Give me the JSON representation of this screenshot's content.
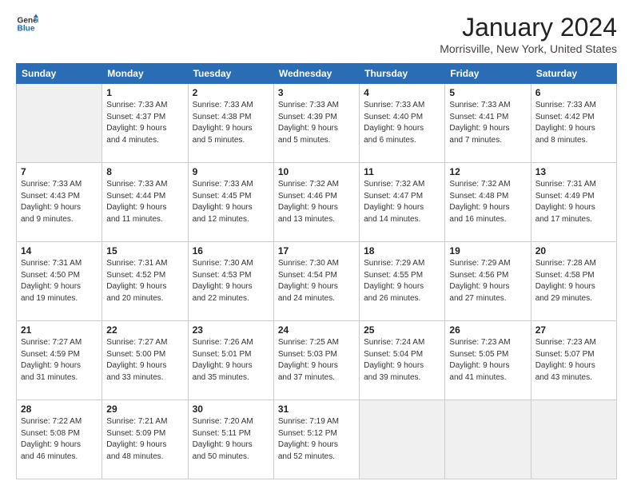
{
  "logo": {
    "line1": "General",
    "line2": "Blue"
  },
  "title": "January 2024",
  "location": "Morrisville, New York, United States",
  "days_header": [
    "Sunday",
    "Monday",
    "Tuesday",
    "Wednesday",
    "Thursday",
    "Friday",
    "Saturday"
  ],
  "weeks": [
    [
      {
        "day": "",
        "info": ""
      },
      {
        "day": "1",
        "info": "Sunrise: 7:33 AM\nSunset: 4:37 PM\nDaylight: 9 hours\nand 4 minutes."
      },
      {
        "day": "2",
        "info": "Sunrise: 7:33 AM\nSunset: 4:38 PM\nDaylight: 9 hours\nand 5 minutes."
      },
      {
        "day": "3",
        "info": "Sunrise: 7:33 AM\nSunset: 4:39 PM\nDaylight: 9 hours\nand 5 minutes."
      },
      {
        "day": "4",
        "info": "Sunrise: 7:33 AM\nSunset: 4:40 PM\nDaylight: 9 hours\nand 6 minutes."
      },
      {
        "day": "5",
        "info": "Sunrise: 7:33 AM\nSunset: 4:41 PM\nDaylight: 9 hours\nand 7 minutes."
      },
      {
        "day": "6",
        "info": "Sunrise: 7:33 AM\nSunset: 4:42 PM\nDaylight: 9 hours\nand 8 minutes."
      }
    ],
    [
      {
        "day": "7",
        "info": "Sunrise: 7:33 AM\nSunset: 4:43 PM\nDaylight: 9 hours\nand 9 minutes."
      },
      {
        "day": "8",
        "info": "Sunrise: 7:33 AM\nSunset: 4:44 PM\nDaylight: 9 hours\nand 11 minutes."
      },
      {
        "day": "9",
        "info": "Sunrise: 7:33 AM\nSunset: 4:45 PM\nDaylight: 9 hours\nand 12 minutes."
      },
      {
        "day": "10",
        "info": "Sunrise: 7:32 AM\nSunset: 4:46 PM\nDaylight: 9 hours\nand 13 minutes."
      },
      {
        "day": "11",
        "info": "Sunrise: 7:32 AM\nSunset: 4:47 PM\nDaylight: 9 hours\nand 14 minutes."
      },
      {
        "day": "12",
        "info": "Sunrise: 7:32 AM\nSunset: 4:48 PM\nDaylight: 9 hours\nand 16 minutes."
      },
      {
        "day": "13",
        "info": "Sunrise: 7:31 AM\nSunset: 4:49 PM\nDaylight: 9 hours\nand 17 minutes."
      }
    ],
    [
      {
        "day": "14",
        "info": "Sunrise: 7:31 AM\nSunset: 4:50 PM\nDaylight: 9 hours\nand 19 minutes."
      },
      {
        "day": "15",
        "info": "Sunrise: 7:31 AM\nSunset: 4:52 PM\nDaylight: 9 hours\nand 20 minutes."
      },
      {
        "day": "16",
        "info": "Sunrise: 7:30 AM\nSunset: 4:53 PM\nDaylight: 9 hours\nand 22 minutes."
      },
      {
        "day": "17",
        "info": "Sunrise: 7:30 AM\nSunset: 4:54 PM\nDaylight: 9 hours\nand 24 minutes."
      },
      {
        "day": "18",
        "info": "Sunrise: 7:29 AM\nSunset: 4:55 PM\nDaylight: 9 hours\nand 26 minutes."
      },
      {
        "day": "19",
        "info": "Sunrise: 7:29 AM\nSunset: 4:56 PM\nDaylight: 9 hours\nand 27 minutes."
      },
      {
        "day": "20",
        "info": "Sunrise: 7:28 AM\nSunset: 4:58 PM\nDaylight: 9 hours\nand 29 minutes."
      }
    ],
    [
      {
        "day": "21",
        "info": "Sunrise: 7:27 AM\nSunset: 4:59 PM\nDaylight: 9 hours\nand 31 minutes."
      },
      {
        "day": "22",
        "info": "Sunrise: 7:27 AM\nSunset: 5:00 PM\nDaylight: 9 hours\nand 33 minutes."
      },
      {
        "day": "23",
        "info": "Sunrise: 7:26 AM\nSunset: 5:01 PM\nDaylight: 9 hours\nand 35 minutes."
      },
      {
        "day": "24",
        "info": "Sunrise: 7:25 AM\nSunset: 5:03 PM\nDaylight: 9 hours\nand 37 minutes."
      },
      {
        "day": "25",
        "info": "Sunrise: 7:24 AM\nSunset: 5:04 PM\nDaylight: 9 hours\nand 39 minutes."
      },
      {
        "day": "26",
        "info": "Sunrise: 7:23 AM\nSunset: 5:05 PM\nDaylight: 9 hours\nand 41 minutes."
      },
      {
        "day": "27",
        "info": "Sunrise: 7:23 AM\nSunset: 5:07 PM\nDaylight: 9 hours\nand 43 minutes."
      }
    ],
    [
      {
        "day": "28",
        "info": "Sunrise: 7:22 AM\nSunset: 5:08 PM\nDaylight: 9 hours\nand 46 minutes."
      },
      {
        "day": "29",
        "info": "Sunrise: 7:21 AM\nSunset: 5:09 PM\nDaylight: 9 hours\nand 48 minutes."
      },
      {
        "day": "30",
        "info": "Sunrise: 7:20 AM\nSunset: 5:11 PM\nDaylight: 9 hours\nand 50 minutes."
      },
      {
        "day": "31",
        "info": "Sunrise: 7:19 AM\nSunset: 5:12 PM\nDaylight: 9 hours\nand 52 minutes."
      },
      {
        "day": "",
        "info": ""
      },
      {
        "day": "",
        "info": ""
      },
      {
        "day": "",
        "info": ""
      }
    ]
  ]
}
